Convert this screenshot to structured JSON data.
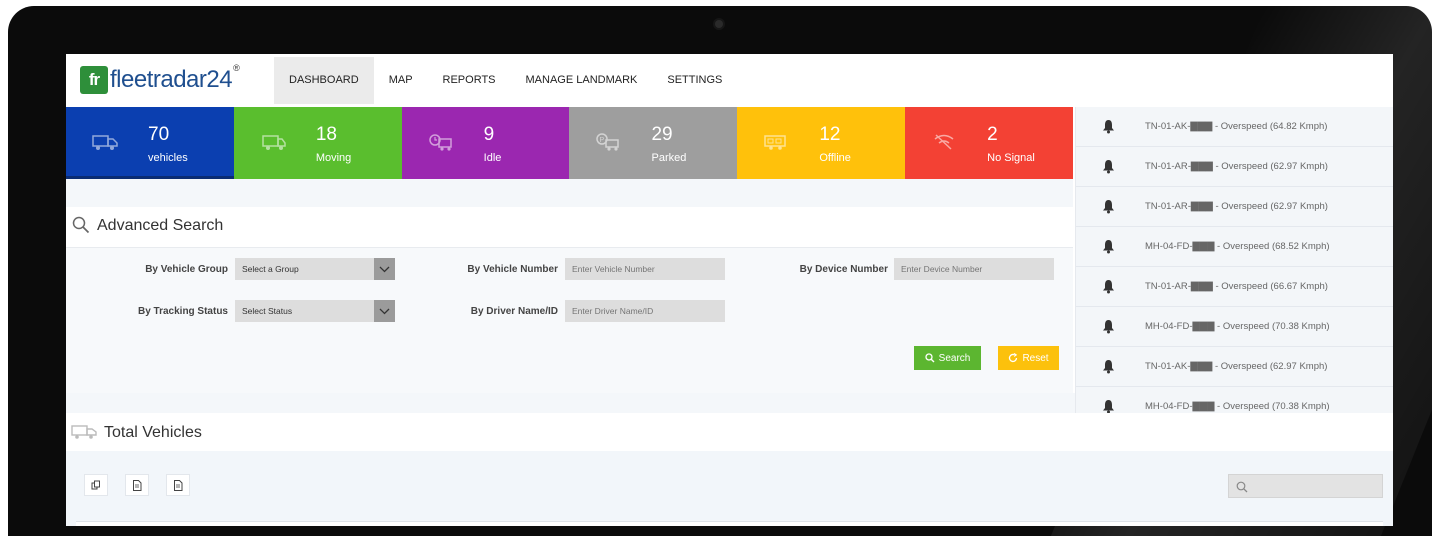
{
  "app": {
    "logo_mark": "fr",
    "logo_text": "fleetradar24",
    "logo_reg": "®"
  },
  "nav": [
    {
      "label": "DASHBOARD",
      "active": true
    },
    {
      "label": "MAP",
      "active": false
    },
    {
      "label": "REPORTS",
      "active": false
    },
    {
      "label": "MANAGE LANDMARK",
      "active": false
    },
    {
      "label": "SETTINGS",
      "active": false
    }
  ],
  "stats": [
    {
      "value": "70",
      "label": "vehicles",
      "color": "#0b3fb0",
      "icon": "truck-icon"
    },
    {
      "value": "18",
      "label": "Moving",
      "color": "#5abe2e",
      "icon": "moving-truck-icon"
    },
    {
      "value": "9",
      "label": "Idle",
      "color": "#9b27b0",
      "icon": "idle-clock-icon"
    },
    {
      "value": "29",
      "label": "Parked",
      "color": "#9e9e9e",
      "icon": "parked-icon"
    },
    {
      "value": "12",
      "label": "Offline",
      "color": "#ffc10b",
      "icon": "offline-trailer-icon"
    },
    {
      "value": "2",
      "label": "No Signal",
      "color": "#f34134",
      "icon": "no-signal-icon"
    }
  ],
  "alerts": [
    {
      "text": "TN-01-AK-▇▇▇ - Overspeed (64.82 Kmph)"
    },
    {
      "text": "TN-01-AR-▇▇▇ - Overspeed (62.97 Kmph)"
    },
    {
      "text": "TN-01-AR-▇▇▇ - Overspeed (62.97 Kmph)"
    },
    {
      "text": "MH-04-FD-▇▇▇ - Overspeed (68.52 Kmph)"
    },
    {
      "text": "TN-01-AR-▇▇▇ - Overspeed (66.67 Kmph)"
    },
    {
      "text": "MH-04-FD-▇▇▇ - Overspeed (70.38 Kmph)"
    },
    {
      "text": "TN-01-AK-▇▇▇ - Overspeed (62.97 Kmph)"
    },
    {
      "text": "MH-04-FD-▇▇▇ - Overspeed (70.38 Kmph)"
    }
  ],
  "advanced_search": {
    "title": "Advanced Search",
    "vehicle_group_label": "By Vehicle Group",
    "vehicle_group_value": "Select a Group",
    "tracking_status_label": "By Tracking Status",
    "tracking_status_value": "Select Status",
    "vehicle_number_label": "By Vehicle Number",
    "vehicle_number_placeholder": "Enter Vehicle Number",
    "driver_label": "By Driver Name/ID",
    "driver_placeholder": "Enter Driver Name/ID",
    "device_number_label": "By Device Number",
    "device_number_placeholder": "Enter Device Number",
    "search_button": "Search",
    "reset_button": "Reset",
    "search_color": "#5cb630",
    "reset_color": "#fcc10c"
  },
  "total_vehicles": {
    "title": "Total Vehicles"
  }
}
